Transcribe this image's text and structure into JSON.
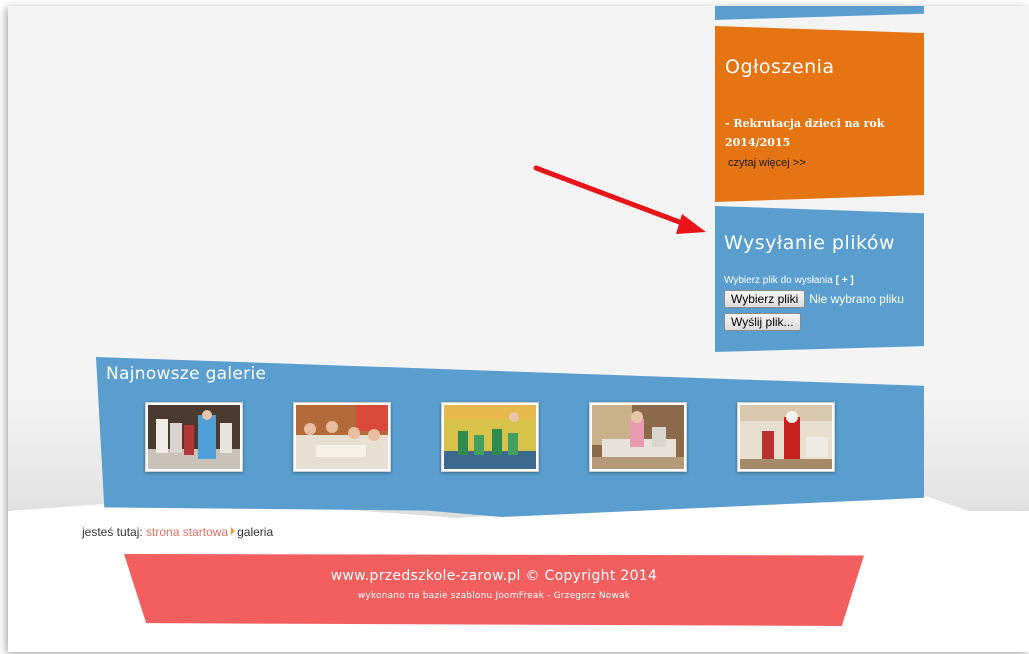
{
  "announcements": {
    "title": "Ogłoszenia",
    "text": "- Rekrutacja dzieci na rok 2014/2015",
    "read_more": "czytaj więcej >>"
  },
  "upload": {
    "title": "Wysyłanie plików",
    "label": "Wybierz plik do wysłania",
    "add_link": "[ + ]",
    "choose_button": "Wybierz pliki",
    "no_file_text": "Nie wybrano pliku",
    "send_button": "Wyślij plik..."
  },
  "gallery": {
    "title": "Najnowsze galerie",
    "thumbnails": [
      {
        "name": "gallery-thumb-1",
        "icon": "photo-icon"
      },
      {
        "name": "gallery-thumb-2",
        "icon": "photo-icon"
      },
      {
        "name": "gallery-thumb-3",
        "icon": "photo-icon"
      },
      {
        "name": "gallery-thumb-4",
        "icon": "photo-icon"
      },
      {
        "name": "gallery-thumb-5",
        "icon": "photo-icon"
      }
    ]
  },
  "breadcrumb": {
    "prefix": "jesteś tutaj:",
    "home_link": "strona startowa",
    "current": "galeria"
  },
  "footer": {
    "copyright": "www.przedszkole-zarow.pl © Copyright 2014",
    "credits": "wykonano na bazie szablonu JoomFreak - Grzegorz Nowak"
  },
  "colors": {
    "orange": "#e57413",
    "blue": "#5a9ecf",
    "footer_red": "#f35f5e",
    "arrow_red": "#e8141a",
    "link": "#e57066"
  }
}
